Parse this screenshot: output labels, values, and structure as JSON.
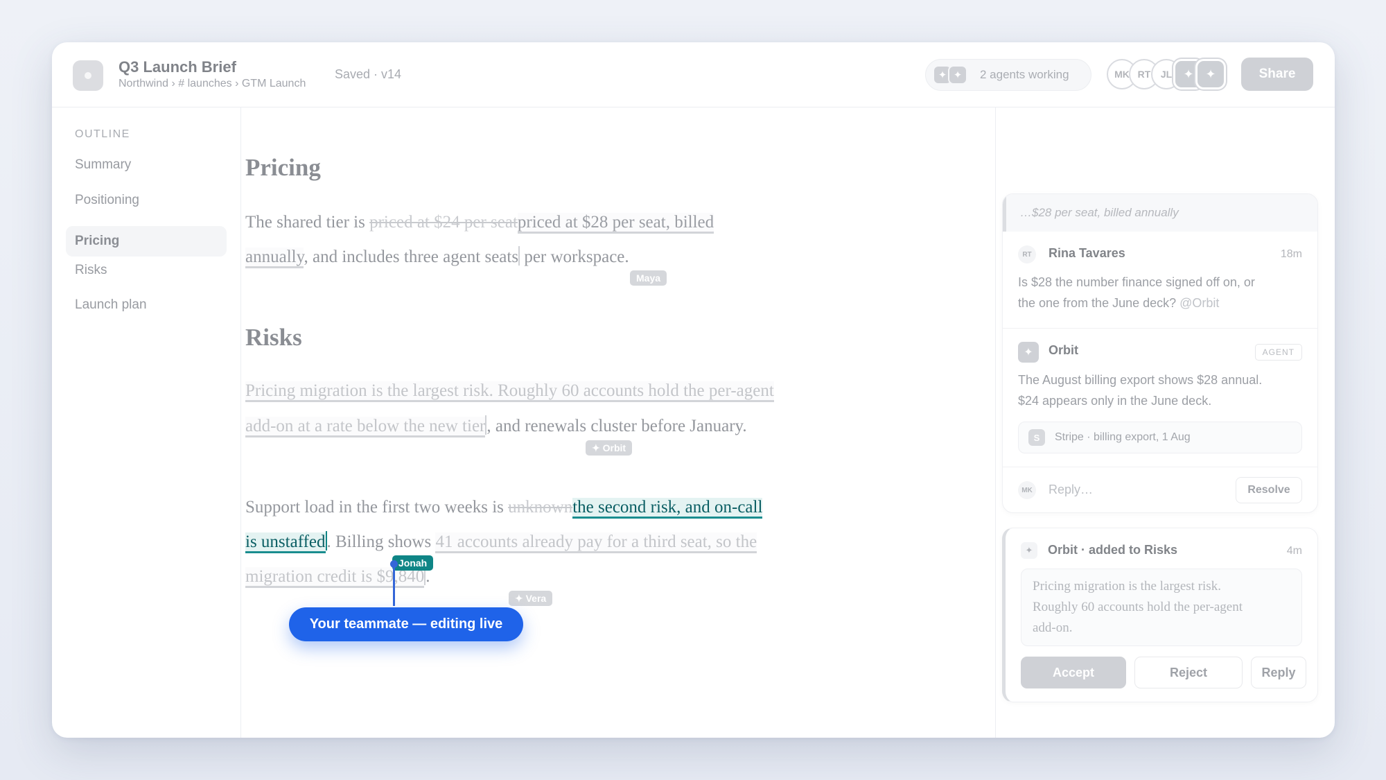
{
  "header": {
    "title": "Q3 Launch Brief",
    "breadcrumb": "Northwind › # launches › GTM Launch",
    "saved_status": "Saved · v14",
    "agents_status": "2 agents working",
    "collaborators": [
      "MK",
      "RT",
      "JL"
    ],
    "share_label": "Share"
  },
  "outline": {
    "label": "OUTLINE",
    "items": [
      "Summary",
      "Positioning",
      "Pricing",
      "Risks",
      "Launch plan"
    ],
    "active": "Pricing"
  },
  "document": {
    "pricing": {
      "heading": "Pricing",
      "line1_prefix": "The shared tier is ",
      "line1_deleted": "priced at $24 per seat",
      "line1_inserted": "priced at $28 per seat, billed",
      "line2_inserted": "annually",
      "line2_rest_a": ", and includes three agent seats",
      "line2_rest_b": " per workspace.",
      "cursor_tag": "Maya"
    },
    "risks": {
      "heading": "Risks",
      "p1_line1": "Pricing migration is the largest risk. Roughly 60 accounts hold the per-agent",
      "p1_line2_ins": "add-on at a rate below the new tier",
      "p1_line2_rest": ", and renewals cluster before January.",
      "orbit_tag": "✦ Orbit",
      "p2_prefix": "Support load in the first two weeks is ",
      "p2_deleted": "unknown",
      "p2_live1": "the second risk, and on-call",
      "p2_live2": "is unstaffed",
      "p2_mid": ". Billing shows ",
      "p2_ins1": "41 accounts already pay for a third seat, so the",
      "p2_ins2": "migration credit is $9,840",
      "p2_end": ".",
      "jonah_tag": "Jonah",
      "vera_tag": "✦ Vera"
    },
    "live_tooltip": "Your teammate — editing live"
  },
  "thread": {
    "quote": "…$28 per seat, billed annually",
    "comment1": {
      "initials": "RT",
      "author": "Rina Tavares",
      "time": "18m",
      "text_a": "Is $28 the number finance signed off on, or",
      "text_b": "the one from the June deck? ",
      "mention": "@Orbit"
    },
    "comment2": {
      "author": "Orbit",
      "badge": "AGENT",
      "text_a": "The August billing export shows $28 annual.",
      "text_b": "$24 appears only in the June deck.",
      "source_icon": "S",
      "source": "Stripe · billing export, 1 Aug"
    },
    "reply": {
      "initials": "MK",
      "placeholder": "Reply…",
      "resolve_label": "Resolve"
    }
  },
  "suggestion": {
    "title": "Orbit · added to Risks",
    "time": "4m",
    "text_a": "Pricing migration is the largest risk.",
    "text_b": "Roughly 60 accounts hold the per-agent",
    "text_c": "add-on.",
    "accept_label": "Accept",
    "reject_label": "Reject",
    "reply_label": "Reply"
  },
  "icons": {
    "agent_symbol": "✦",
    "colors": {
      "live_teal": "#0f8586",
      "live_cursor_blue": "#1f63e9"
    }
  }
}
